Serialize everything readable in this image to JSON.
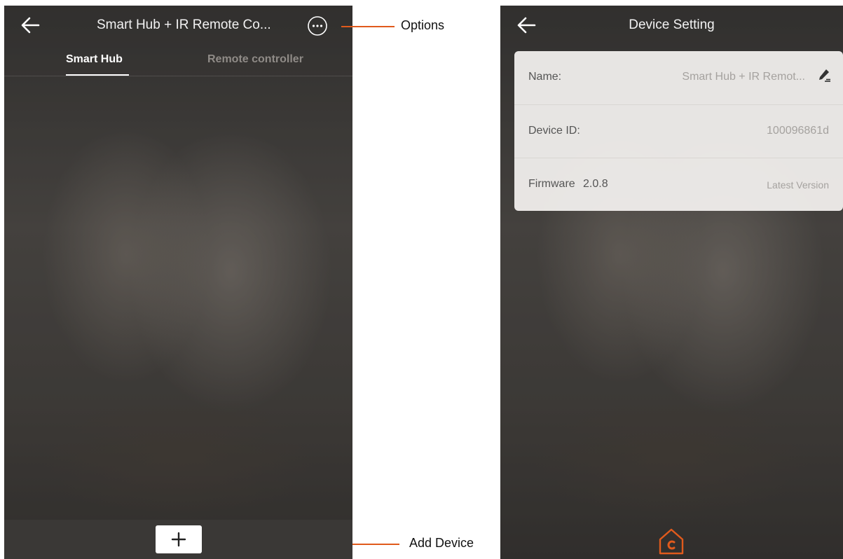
{
  "colors": {
    "accent": "#e05a1c",
    "overlay_dark": "#3a3836",
    "card_bg": "#f2f0ee"
  },
  "left_screen": {
    "title": "Smart Hub + IR Remote Co...",
    "tabs": [
      {
        "label": "Smart Hub",
        "active": true
      },
      {
        "label": "Remote controller",
        "active": false
      }
    ],
    "icons": {
      "back": "arrow-left-icon",
      "more": "more-options-icon",
      "add": "plus-icon"
    }
  },
  "right_screen": {
    "title": "Device Setting",
    "rows": {
      "name": {
        "label": "Name:",
        "value": "Smart Hub + IR Remot..."
      },
      "device_id": {
        "label": "Device ID:",
        "value": "100096861d"
      },
      "firmware": {
        "label": "Firmware",
        "version": "2.0.8",
        "status": "Latest Version"
      }
    },
    "icons": {
      "back": "arrow-left-icon",
      "edit": "edit-icon",
      "home": "home-logo-icon"
    }
  },
  "callouts": {
    "options": "Options",
    "add_device": "Add Device"
  }
}
